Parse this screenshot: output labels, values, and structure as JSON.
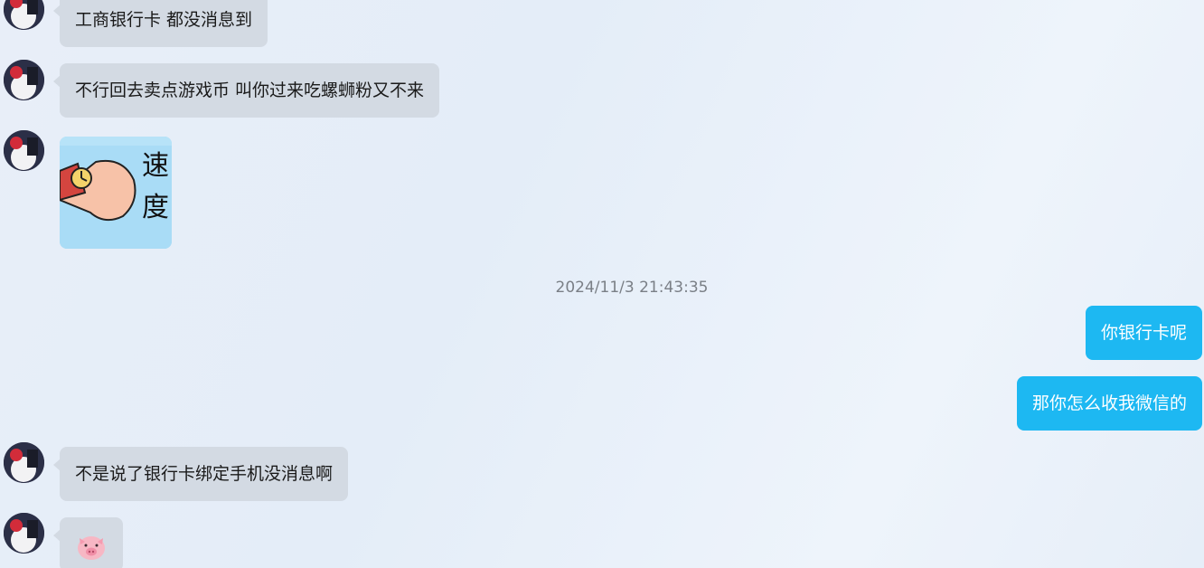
{
  "messages": [
    {
      "side": "in",
      "text": "工商银行卡 都没消息到"
    },
    {
      "side": "in",
      "text": "不行回去卖点游戏币  叫你过来吃螺蛳粉又不来"
    },
    {
      "side": "in",
      "type": "sticker",
      "sticker_text": "速度",
      "icon": "hand-watch-sticker"
    },
    {
      "side": "in",
      "text": "不是说了银行卡绑定手机没消息啊"
    },
    {
      "side": "in",
      "type": "emoji",
      "icon": "pig-face-emoji"
    }
  ],
  "timestamp": "2024/11/3 21:43:35",
  "outgoing": [
    {
      "text": "你银行卡呢"
    },
    {
      "text": "那你怎么收我微信的"
    }
  ],
  "colors": {
    "incoming_bubble": "#d3dae3",
    "outgoing_bubble": "#1db8f2",
    "timestamp": "#7a7f86"
  }
}
